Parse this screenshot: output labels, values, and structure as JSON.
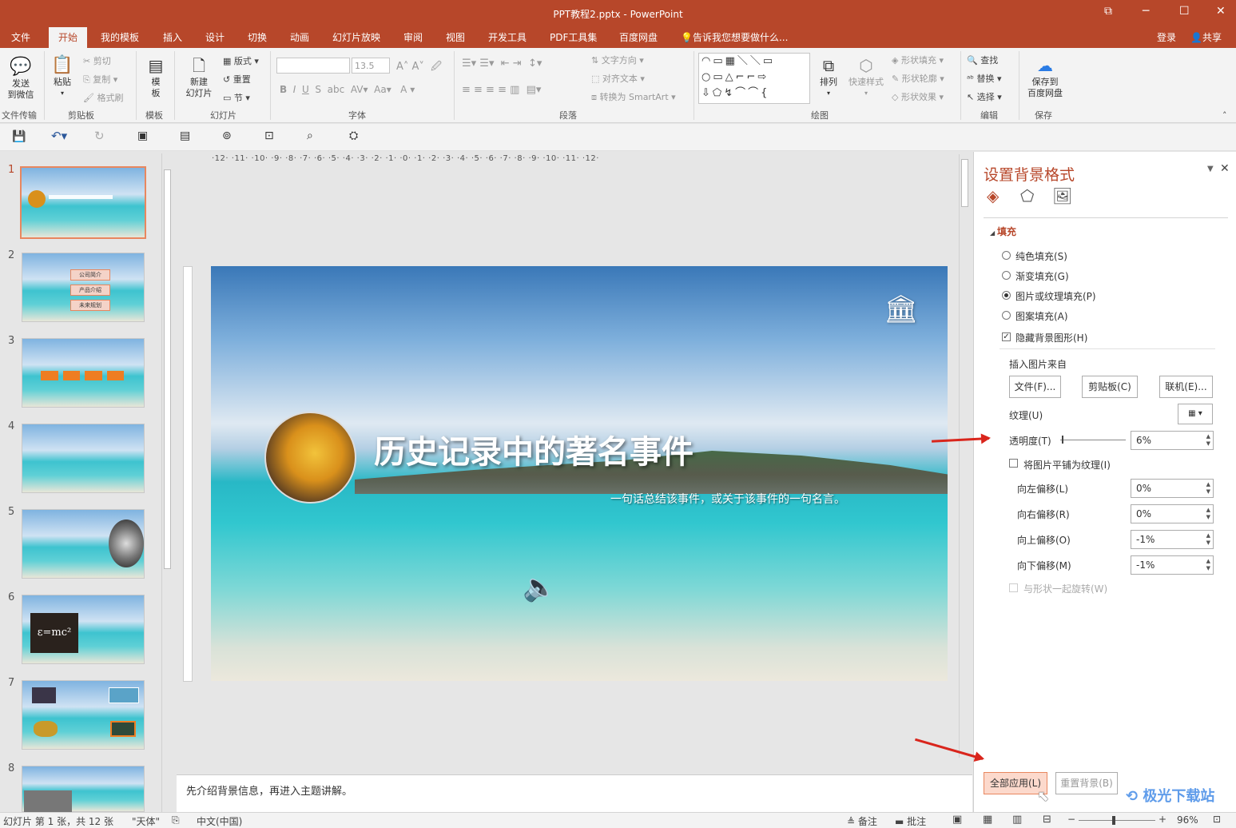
{
  "window": {
    "title": "PPT教程2.pptx - PowerPoint"
  },
  "tabs": [
    "文件",
    "开始",
    "我的模板",
    "插入",
    "设计",
    "切换",
    "动画",
    "幻灯片放映",
    "审阅",
    "视图",
    "开发工具",
    "PDF工具集",
    "百度网盘"
  ],
  "tell_me": "告诉我您想要做什么...",
  "account": {
    "login": "登录",
    "share": "共享"
  },
  "ribbon": {
    "send": "发送\n到微信",
    "group_transfer": "文件传输",
    "paste": "粘贴",
    "cut": "剪切",
    "copy": "复制",
    "format_painter": "格式刷",
    "group_clipboard": "剪贴板",
    "template": "模\n板",
    "group_template": "模板",
    "new_slide": "新建\n幻灯片",
    "layout": "版式",
    "reset": "重置",
    "section": "节",
    "group_slides": "幻灯片",
    "font_size": "13.5",
    "group_font": "字体",
    "text_direction": "文字方向",
    "align_text": "对齐文本",
    "convert_smartart": "转换为 SmartArt",
    "group_paragraph": "段落",
    "arrange": "排列",
    "quick_styles": "快速样式",
    "shape_fill": "形状填充",
    "shape_outline": "形状轮廓",
    "shape_effects": "形状效果",
    "group_drawing": "绘图",
    "find": "查找",
    "replace": "替换",
    "select": "选择",
    "group_editing": "编辑",
    "save_baidu": "保存到\n百度网盘",
    "group_save": "保存"
  },
  "ruler": {
    "h": "·12· ·11· ·10· ·9· ·8· ·7· ·6· ·5· ·4· ·3· ·2· ·1· ·0· ·1· ·2· ·3· ·4· ·5· ·6· ·7· ·8· ·9· ·10· ·11· ·12·"
  },
  "slides": {
    "numbers": [
      "1",
      "2",
      "3",
      "4",
      "5",
      "6",
      "7",
      "8"
    ]
  },
  "thumb2": {
    "items": [
      "公司简介",
      "产品介绍",
      "未来规划"
    ]
  },
  "slide": {
    "title": "历史记录中的著名事件",
    "subtitle": "一句话总结该事件，或关于该事件的一句名言。"
  },
  "notes": "先介绍背景信息，再进入主题讲解。",
  "pane": {
    "title": "设置背景格式",
    "section_fill": "填充",
    "solid_fill": "纯色填充(S)",
    "gradient_fill": "渐变填充(G)",
    "picture_fill": "图片或纹理填充(P)",
    "pattern_fill": "图案填充(A)",
    "hide_bg": "隐藏背景图形(H)",
    "insert_from": "插入图片来自",
    "file_btn": "文件(F)...",
    "clipboard_btn": "剪贴板(C)",
    "online_btn": "联机(E)...",
    "texture": "纹理(U)",
    "transparency": "透明度(T)",
    "transparency_value": "6%",
    "tile": "将图片平铺为纹理(I)",
    "offset_left": "向左偏移(L)",
    "offset_left_value": "0%",
    "offset_right": "向右偏移(R)",
    "offset_right_value": "0%",
    "offset_top": "向上偏移(O)",
    "offset_top_value": "-1%",
    "offset_bottom": "向下偏移(M)",
    "offset_bottom_value": "-1%",
    "rotate_with_shape": "与形状一起旋转(W)",
    "apply_all": "全部应用(L)",
    "reset_bg": "重置背景(B)"
  },
  "status": {
    "slide_info": "幻灯片 第 1 张，共 12 张",
    "theme": "\"天体\"",
    "language": "中文(中国)",
    "notes": "备注",
    "comments": "批注",
    "zoom": "96%"
  },
  "watermark": "极光下载站"
}
